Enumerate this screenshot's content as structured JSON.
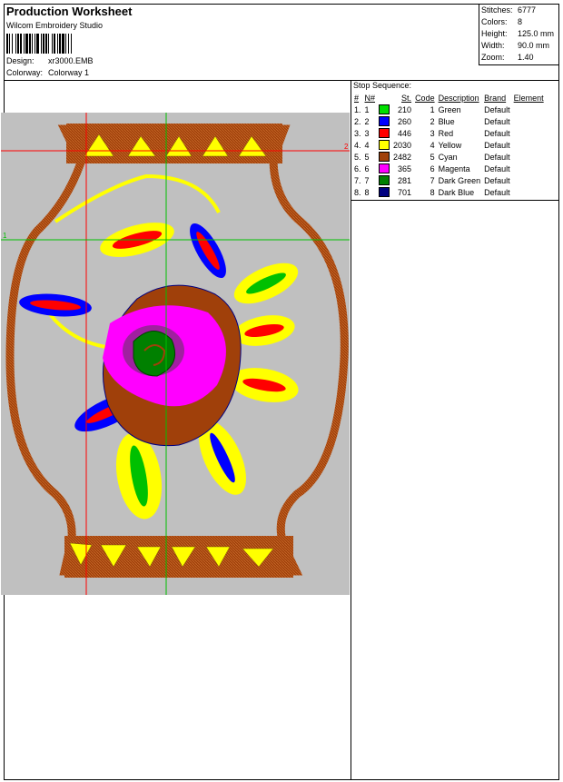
{
  "header": {
    "title": "Production Worksheet",
    "software": "Wilcom Embroidery Studio",
    "design_label": "Design:",
    "design_value": "xr3000.EMB",
    "colorway_label": "Colorway:",
    "colorway_value": "Colorway 1"
  },
  "stats": [
    {
      "label": "Stitches:",
      "value": "6777"
    },
    {
      "label": "Colors:",
      "value": "8"
    },
    {
      "label": "Height:",
      "value": "125.0 mm"
    },
    {
      "label": "Width:",
      "value": "90.0 mm"
    },
    {
      "label": "Zoom:",
      "value": "1.40"
    }
  ],
  "stop_sequence": {
    "title": "Stop Sequence:",
    "headers": [
      "#",
      "N#",
      "",
      "St.",
      "Code",
      "Description",
      "Brand",
      "Element"
    ],
    "rows": [
      {
        "index": "1.",
        "n": "1",
        "color": "#00e000",
        "stitches": "210",
        "code": "1",
        "description": "Green",
        "brand": "Default",
        "element": ""
      },
      {
        "index": "2.",
        "n": "2",
        "color": "#0000ff",
        "stitches": "260",
        "code": "2",
        "description": "Blue",
        "brand": "Default",
        "element": ""
      },
      {
        "index": "3.",
        "n": "3",
        "color": "#ff0000",
        "stitches": "446",
        "code": "3",
        "description": "Red",
        "brand": "Default",
        "element": ""
      },
      {
        "index": "4.",
        "n": "4",
        "color": "#ffff00",
        "stitches": "2030",
        "code": "4",
        "description": "Yellow",
        "brand": "Default",
        "element": ""
      },
      {
        "index": "5.",
        "n": "5",
        "color": "#a0400a",
        "stitches": "2482",
        "code": "5",
        "description": "Cyan",
        "brand": "Default",
        "element": ""
      },
      {
        "index": "6.",
        "n": "6",
        "color": "#ff00ff",
        "stitches": "365",
        "code": "6",
        "description": "Magenta",
        "brand": "Default",
        "element": ""
      },
      {
        "index": "7.",
        "n": "7",
        "color": "#008000",
        "stitches": "281",
        "code": "7",
        "description": "Dark Green",
        "brand": "Default",
        "element": ""
      },
      {
        "index": "8.",
        "n": "8",
        "color": "#000080",
        "stitches": "701",
        "code": "8",
        "description": "Dark Blue",
        "brand": "Default",
        "element": ""
      }
    ]
  },
  "design_preview": {
    "marker_right": "2",
    "marker_left": "1",
    "colors": {
      "background": "#c0c0c0",
      "brown": "#a0400a",
      "yellow": "#ffff00",
      "magenta": "#ff00ff",
      "green": "#008000",
      "blue": "#0000ff",
      "red": "#ff0000",
      "guide": "#ff0000",
      "guide2": "#00c000"
    }
  }
}
